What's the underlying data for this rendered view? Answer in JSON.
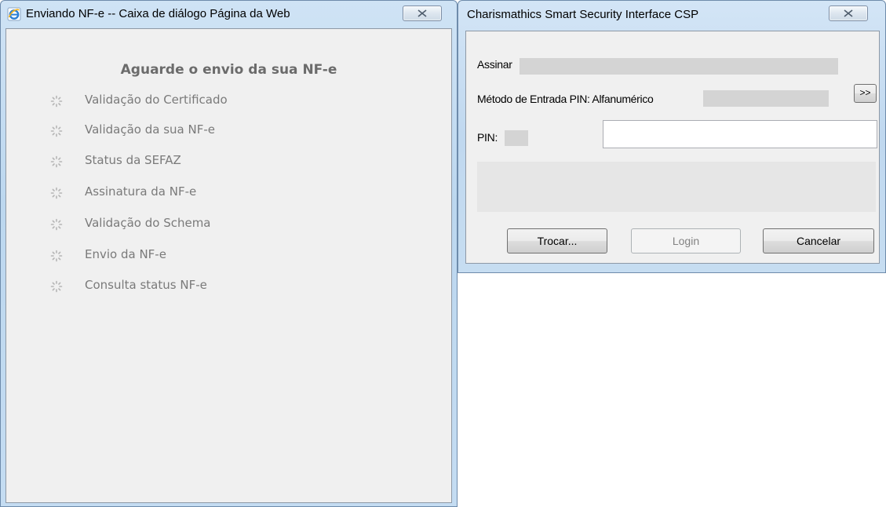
{
  "left_dialog": {
    "title": "Enviando NF-e -- Caixa de diálogo Página da Web",
    "heading": "Aguarde o envio da sua NF-e",
    "steps": [
      {
        "label": "Validação do Certificado"
      },
      {
        "label": "Validação da sua NF-e"
      },
      {
        "label": "Status da SEFAZ"
      },
      {
        "label": "Assinatura da NF-e"
      },
      {
        "label": "Validação do Schema"
      },
      {
        "label": "Envio da NF-e"
      },
      {
        "label": "Consulta status NF-e"
      }
    ],
    "icon": "internet-explorer-icon"
  },
  "right_dialog": {
    "title": "Charismathics Smart Security Interface CSP",
    "sign_label": "Assinar",
    "pin_method_label": "Método de Entrada PIN: Alfanumérico",
    "expand_label": ">>",
    "pin_label": "PIN:",
    "pin_value": "",
    "buttons": {
      "change": "Trocar...",
      "login": "Login",
      "cancel": "Cancelar"
    }
  },
  "colors": {
    "title_bar": "#c4dcf2",
    "client_bg": "#f0f0f0",
    "step_text": "#7a7a7a",
    "redaction": "#d4d4d4"
  }
}
